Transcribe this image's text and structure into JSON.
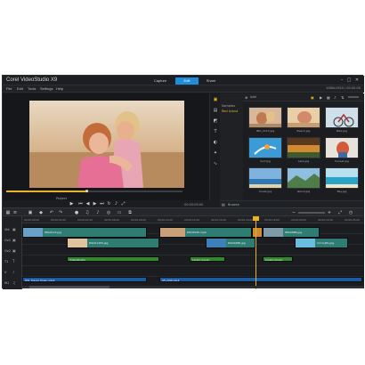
{
  "app": {
    "title": "Corel VideoStudio X9"
  },
  "tabs": [
    {
      "label": "Capture"
    },
    {
      "label": "Edit"
    },
    {
      "label": "Share"
    }
  ],
  "menu": [
    "File",
    "Edit",
    "Tools",
    "Settings",
    "Help"
  ],
  "status": "1080x1920 / 00:00:00",
  "player": {
    "mode_label": "Project",
    "timecode": "00:00:05:00"
  },
  "library": {
    "add_label": "Add",
    "folders": [
      "Samples",
      "Red Island"
    ],
    "bottom_label": "Browse",
    "thumbs": [
      {
        "caption": "IMG_0113.jpg"
      },
      {
        "caption": "Beach.jpg"
      },
      {
        "caption": "Bike.jpg"
      },
      {
        "caption": "Surf.jpg"
      },
      {
        "caption": "Lake.jpg"
      },
      {
        "caption": "Sunset.jpg"
      },
      {
        "caption": "Coast.jpg"
      },
      {
        "caption": "Island.jpg"
      },
      {
        "caption": "Bay.jpg"
      }
    ]
  },
  "timeline": {
    "ticks": [
      "00:00:00:00",
      "00:00:02:00",
      "00:00:04:00",
      "00:00:06:00",
      "00:00:08:00",
      "00:00:10:00",
      "00:00:12:00",
      "00:00:14:00",
      "00:00:16:00",
      "00:00:18:00",
      "00:00:20:00",
      "00:00:22:00",
      "00:00:24:00"
    ],
    "tracks": [
      {
        "label": "Vid"
      },
      {
        "label": "Ov1"
      },
      {
        "label": "Ov2"
      },
      {
        "label": "T1"
      },
      {
        "label": "V"
      },
      {
        "label": "M1"
      }
    ],
    "clips": {
      "v1": "IMG0113.jpg",
      "v2": "video2.mp4",
      "v3": "DSC0045.mp4",
      "v4": "IMG0088.jpg",
      "ov1": "DSC01205.jpg",
      "ov2": "DSC0088.jpg",
      "ov3": "1114.JPG.jpg",
      "t1": "VideoStudio",
      "t2": "Lorem ipsum",
      "t3": "Lorem ipsum",
      "a1": "HW_Travel_Music.mp3",
      "a2": "SF+MIX.mp3"
    }
  },
  "colors": {
    "accent": "#1e8ed8",
    "highlight": "#e8b326",
    "video_clip": "#2f7d72",
    "audio_clip": "#1b5aa0",
    "title_clip": "#2f8a2a"
  }
}
